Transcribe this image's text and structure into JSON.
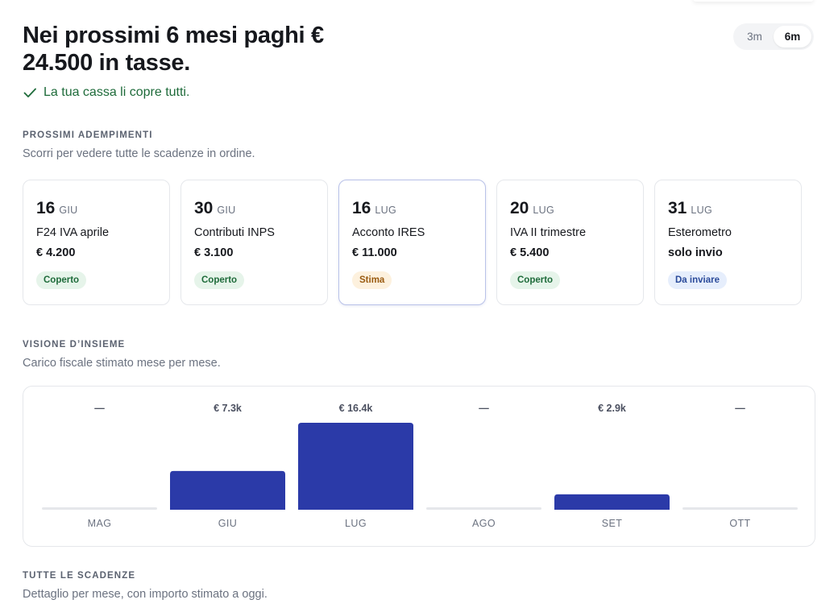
{
  "header": {
    "headline": "Nei prossimi 6 mesi paghi € 24.500 in tasse.",
    "status": "La tua cassa li copre tutti."
  },
  "range_toggle": {
    "options": [
      "3m",
      "6m"
    ],
    "selected": "6m"
  },
  "upcoming": {
    "label": "PROSSIMI ADEMPIMENTI",
    "subtitle": "Scorri per vedere tutte le scadenze in ordine.",
    "cards": [
      {
        "day": "16",
        "month": "GIU",
        "title": "F24 IVA aprile",
        "amount": "€ 4.200",
        "badge": "Coperto",
        "badge_type": "ok"
      },
      {
        "day": "30",
        "month": "GIU",
        "title": "Contributi INPS",
        "amount": "€ 3.100",
        "badge": "Coperto",
        "badge_type": "ok"
      },
      {
        "day": "16",
        "month": "LUG",
        "title": "Acconto IRES",
        "amount": "€ 11.000",
        "badge": "Stima",
        "badge_type": "warn"
      },
      {
        "day": "20",
        "month": "LUG",
        "title": "IVA II trimestre",
        "amount": "€ 5.400",
        "badge": "Coperto",
        "badge_type": "ok"
      },
      {
        "day": "31",
        "month": "LUG",
        "title": "Esterometro",
        "amount": "solo invio",
        "badge": "Da inviare",
        "badge_type": "info"
      }
    ]
  },
  "overview": {
    "label": "VISIONE D’INSIEME",
    "subtitle": "Carico fiscale stimato mese per mese."
  },
  "chart_data": {
    "type": "bar",
    "categories": [
      "MAG",
      "GIU",
      "LUG",
      "AGO",
      "SET",
      "OTT"
    ],
    "values": [
      0,
      7.3,
      16.4,
      0,
      2.9,
      0
    ],
    "value_labels": [
      "—",
      "€ 7.3k",
      "€ 16.4k",
      "—",
      "€ 2.9k",
      "—"
    ],
    "unit": "€ k",
    "ylim": [
      0,
      16.4
    ],
    "bar_color": "#2b3aa8",
    "empty_color": "#e5e7eb"
  },
  "all_deadlines": {
    "label": "TUTTE LE SCADENZE",
    "subtitle": "Dettaglio per mese, con importo stimato a oggi."
  }
}
